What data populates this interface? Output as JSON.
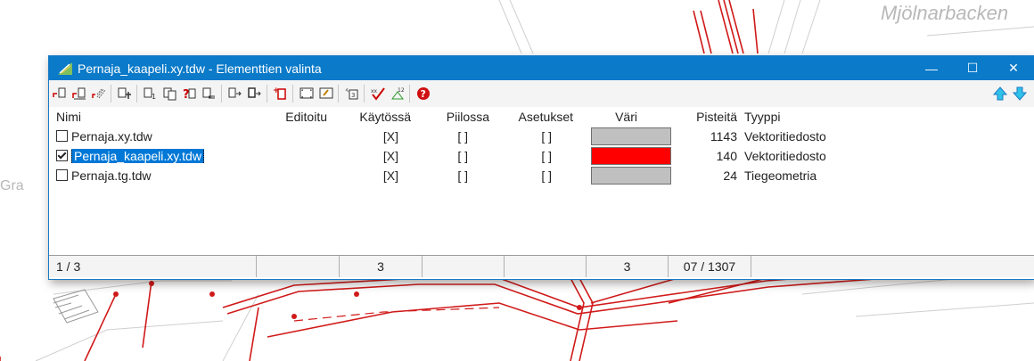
{
  "background_map": {
    "label_top": "Mjölnarbacken",
    "label_left": "Gra",
    "line_color": "#d11a1a"
  },
  "window": {
    "title": "Pernaja_kaapeli.xy.tdw - Elementtien valinta",
    "titlebar_color": "#0a7ac9",
    "controls": {
      "minimize": "—",
      "maximize": "☐",
      "close": "✕"
    }
  },
  "toolbar": {
    "groups": [
      [
        "new-element-icon",
        "new-element-alt-icon",
        "pattern-icon"
      ],
      [
        "select-add-icon"
      ],
      [
        "select-one-icon",
        "select-all-icon",
        "select-query-icon",
        "select-copy-icon"
      ],
      [
        "move-up-icon",
        "move-down-icon"
      ],
      [
        "new-doc-icon"
      ],
      [
        "zoom-extent-icon",
        "view-icon"
      ],
      [
        "sort-icon"
      ],
      [
        "delete-select-icon",
        "coordinate-icon"
      ],
      [
        "help-icon"
      ]
    ],
    "up_arrow": "up-arrow-icon",
    "down_arrow": "down-arrow-icon"
  },
  "table": {
    "headers": {
      "name": "Nimi",
      "edited": "Editoitu",
      "in_use": "Käytössä",
      "hidden": "Piilossa",
      "settings": "Asetukset",
      "color": "Väri",
      "points": "Pisteitä",
      "type": "Tyyppi"
    },
    "rows": [
      {
        "checked": false,
        "selected": false,
        "name": "Pernaja.xy.tdw",
        "edited": "",
        "in_use": "[X]",
        "hidden": "[ ]",
        "settings": "[ ]",
        "color": "#c0c0c0",
        "points": "1143",
        "type": "Vektoritiedosto"
      },
      {
        "checked": true,
        "selected": true,
        "name": "Pernaja_kaapeli.xy.tdw",
        "edited": "",
        "in_use": "[X]",
        "hidden": "[ ]",
        "settings": "[ ]",
        "color": "#ff0000",
        "points": "140",
        "type": "Vektoritiedosto"
      },
      {
        "checked": false,
        "selected": false,
        "name": "Pernaja.tg.tdw",
        "edited": "",
        "in_use": "[X]",
        "hidden": "[ ]",
        "settings": "[ ]",
        "color": "#c0c0c0",
        "points": "24",
        "type": "Tiegeometria"
      }
    ]
  },
  "status_bar": {
    "position": "1 / 3",
    "edited": "",
    "in_use_count": "3",
    "hidden_count": "",
    "settings_count": "",
    "color_count": "3",
    "points_total": "07 / 1307",
    "type": ""
  }
}
